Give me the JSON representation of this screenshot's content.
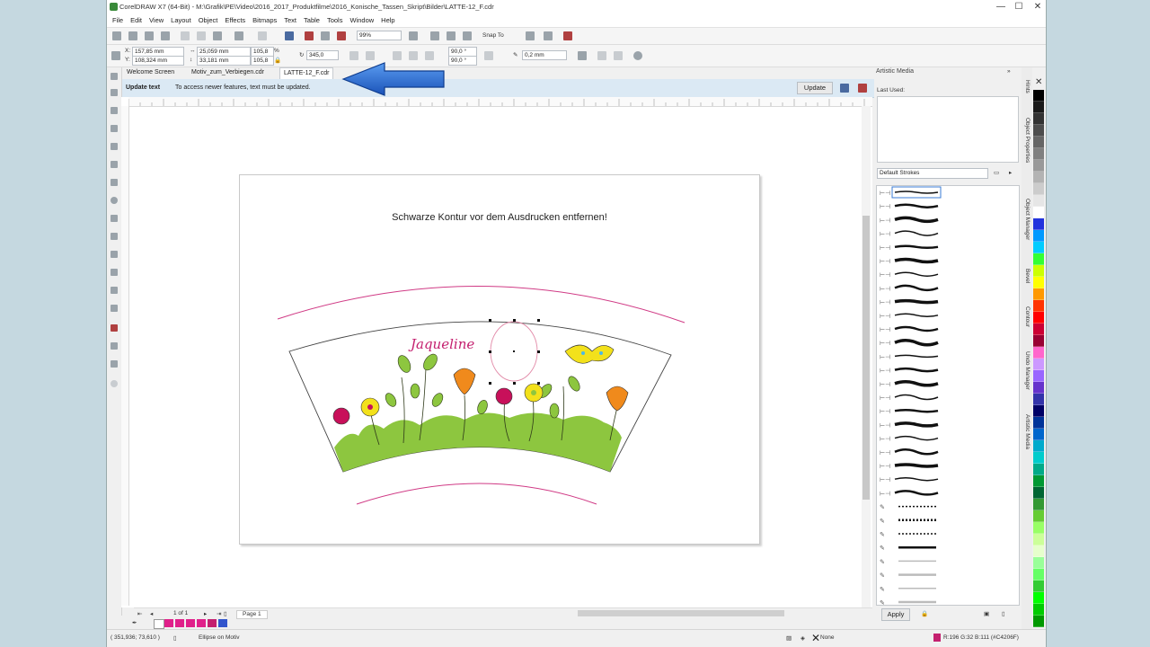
{
  "window": {
    "title": "CorelDRAW X7 (64-Bit) - M:\\Grafik\\PE\\Video\\2016_2017_Produktfilme\\2016_Konische_Tassen_Skript\\Bilder\\LATTE-12_F.cdr",
    "controls": {
      "minimize": "—",
      "maximize": "☐",
      "close": "✕"
    }
  },
  "menu": [
    "File",
    "Edit",
    "View",
    "Layout",
    "Object",
    "Effects",
    "Bitmaps",
    "Text",
    "Table",
    "Tools",
    "Window",
    "Help"
  ],
  "toolbar": {
    "zoom": "99%",
    "snap_to": "Snap To"
  },
  "property_bar": {
    "x_pos": "157,85 mm",
    "y_pos": "108,324 mm",
    "width": "25,059 mm",
    "height": "33,181 mm",
    "scale_w": "105,8",
    "scale_h": "105,8",
    "percent": "%",
    "rotation": "345,0",
    "angle_start": "90,0 °",
    "angle_end": "90,0 °",
    "outline_width": "0,2 mm"
  },
  "tabs": [
    {
      "label": "Welcome Screen"
    },
    {
      "label": "Motiv_zum_Verbiegen.cdr"
    },
    {
      "label": "LATTE-12_F.cdr"
    }
  ],
  "infobar": {
    "label": "Update text",
    "message": "To access newer features, text must be updated.",
    "button": "Update"
  },
  "page_text": "Schwarze Kontur vor dem Ausdrucken entfernen!",
  "artwork_name": "Jaqueline",
  "page_nav": {
    "counter": "1 of 1",
    "page_tab": "Page 1"
  },
  "docker": {
    "title": "Artistic Media",
    "last_used": "Last Used:",
    "category": "Default Strokes",
    "apply_button": "Apply"
  },
  "vertical_tabs": [
    "Hints",
    "Object Properties",
    "Object Manager",
    "Bevel",
    "Contour",
    "Undo Manager",
    "Artistic Media"
  ],
  "status": {
    "coords": "( 351,936; 73,610 )",
    "selection": "Ellipse on Motiv",
    "fill": "None",
    "outline_color": "R:196 G:32 B:111 (#C4206F)"
  },
  "colors": {
    "pink": "#c4206f",
    "arrow_blue": "#2b6fd6",
    "grass": "#8dc63f",
    "flower_yellow": "#f3e11b",
    "flower_orange": "#f08a1c",
    "flower_magenta": "#c8105a"
  },
  "palette_colors": [
    "#000000",
    "#1a1a1a",
    "#333333",
    "#4d4d4d",
    "#666666",
    "#808080",
    "#999999",
    "#b3b3b3",
    "#cccccc",
    "#e6e6e6",
    "#ffffff",
    "#2233dd",
    "#0099ff",
    "#00ccff",
    "#33ff33",
    "#ccff00",
    "#ffff00",
    "#ff9900",
    "#ff3300",
    "#ff0000",
    "#cc0033",
    "#990033",
    "#ff66cc",
    "#cc99ff",
    "#9966ff",
    "#6633cc",
    "#3333aa",
    "#000066",
    "#003399",
    "#0066cc",
    "#00aacc",
    "#00cccc",
    "#00aa88",
    "#009933",
    "#006633",
    "#339933",
    "#66cc33",
    "#99ff66",
    "#ccff99",
    "#e6ffcc",
    "#99ff99",
    "#66ff66",
    "#33cc33",
    "#00ff00",
    "#00cc00",
    "#009900"
  ]
}
